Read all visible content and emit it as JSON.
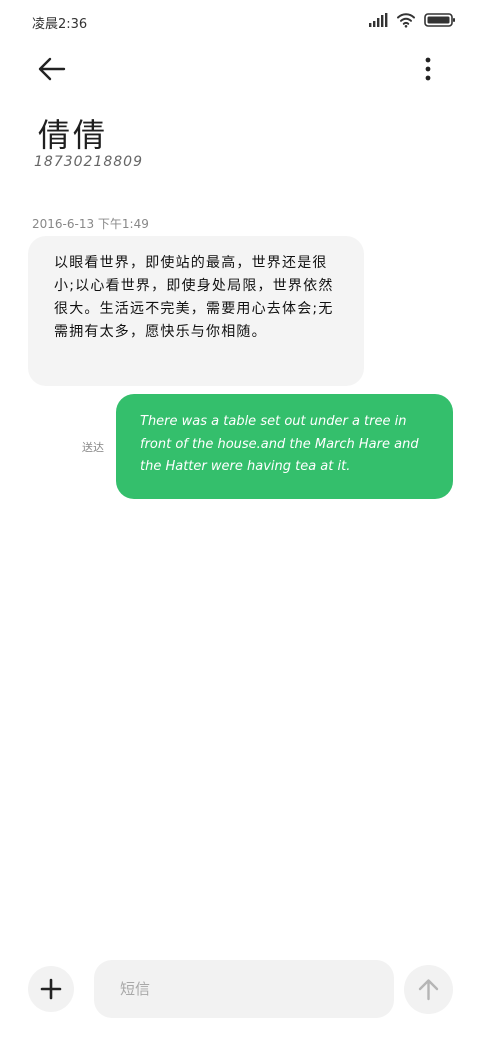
{
  "status_bar": {
    "time": "凌晨2:36",
    "icons": [
      "signal-icon",
      "wifi-icon",
      "battery-icon"
    ]
  },
  "header": {
    "back_icon": "arrow-left-icon",
    "more_icon": "more-vertical-icon"
  },
  "contact": {
    "name": "倩倩",
    "number": "18730218809"
  },
  "conversation": {
    "timestamp": "2016-6-13 下午1:49",
    "incoming": {
      "text": "以眼看世界，即使站的最高，世界还是很小;以心看世界，即使身处局限，世界依然很大。生活远不完美，需要用心去体会;无需拥有太多，愿快乐与你相随。"
    },
    "outgoing": {
      "status": "送达",
      "text": "There was a table set out under a tree in front of the house.and the March Hare and the Hatter were having tea at it."
    }
  },
  "composer": {
    "add_icon": "plus-icon",
    "placeholder": "短信",
    "send_icon": "arrow-up-icon"
  },
  "colors": {
    "outgoing_bubble": "#34bf6c",
    "incoming_bubble": "#f4f4f4",
    "control_bg": "#f2f2f2"
  }
}
